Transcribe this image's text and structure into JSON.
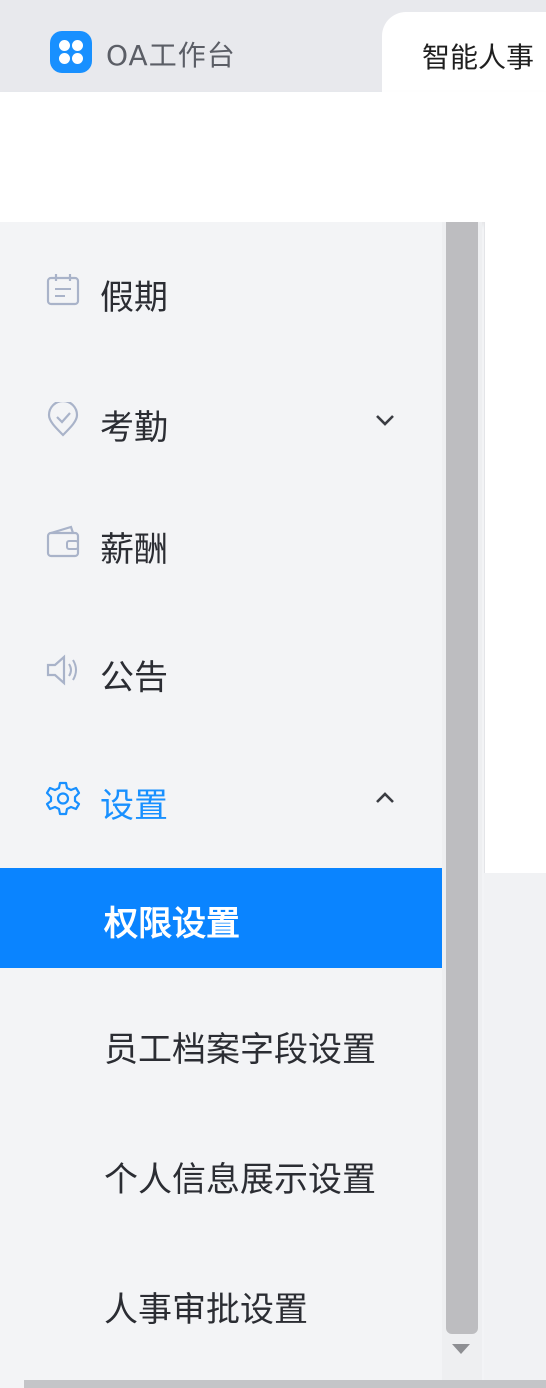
{
  "topbar": {
    "app_title": "OA工作台",
    "active_tab": "智能人事"
  },
  "sidebar": {
    "items": [
      {
        "label": "假期",
        "icon": "calendar-icon"
      },
      {
        "label": "考勤",
        "icon": "location-pin-icon",
        "chevron": "down"
      },
      {
        "label": "薪酬",
        "icon": "wallet-icon"
      },
      {
        "label": "公告",
        "icon": "speaker-icon"
      },
      {
        "label": "设置",
        "icon": "gear-icon",
        "chevron": "up",
        "expanded": true
      }
    ],
    "submenu": [
      {
        "label": "权限设置",
        "selected": true
      },
      {
        "label": "员工档案字段设置"
      },
      {
        "label": "个人信息展示设置"
      },
      {
        "label": "人事审批设置"
      }
    ]
  },
  "colors": {
    "accent": "#1890ff",
    "selected_bg": "#0a84ff",
    "icon_stroke": "#a9b3c9"
  }
}
